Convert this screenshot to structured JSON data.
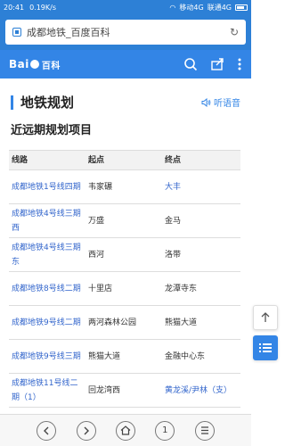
{
  "status": {
    "time": "20:41",
    "speed": "0.19K/s",
    "network1": "移动4G",
    "network2": "联通4G"
  },
  "browser": {
    "url_title": "成都地铁_百度百科"
  },
  "app": {
    "logo_text": "Bai",
    "logo_pedia": "百科"
  },
  "section": {
    "title": "地铁规划",
    "listen_label": "听语音"
  },
  "subsection": {
    "title": "近远期规划项目"
  },
  "table": {
    "headers": [
      "线路",
      "起点",
      "终点"
    ],
    "rows": [
      {
        "line": "成都地铁1号线四期",
        "start": "韦家碾",
        "end": "大丰"
      },
      {
        "line": "成都地铁4号线三期西",
        "start": "万盛",
        "end": "金马"
      },
      {
        "line": "成都地铁4号线三期东",
        "start": "西河",
        "end": "洛带"
      },
      {
        "line": "成都地铁8号线二期",
        "start": "十里店",
        "end": "龙潭寺东"
      },
      {
        "line": "成都地铁9号线二期",
        "start": "两河森林公园",
        "end": "熊猫大道"
      },
      {
        "line": "成都地铁9号线三期",
        "start": "熊猫大道",
        "end": "金融中心东"
      },
      {
        "line": "成都地铁11号线二期（1）",
        "start": "回龙湾西",
        "end": "黄龙溪/尹林（支）"
      }
    ]
  },
  "bottom": {
    "page_count": "1"
  }
}
